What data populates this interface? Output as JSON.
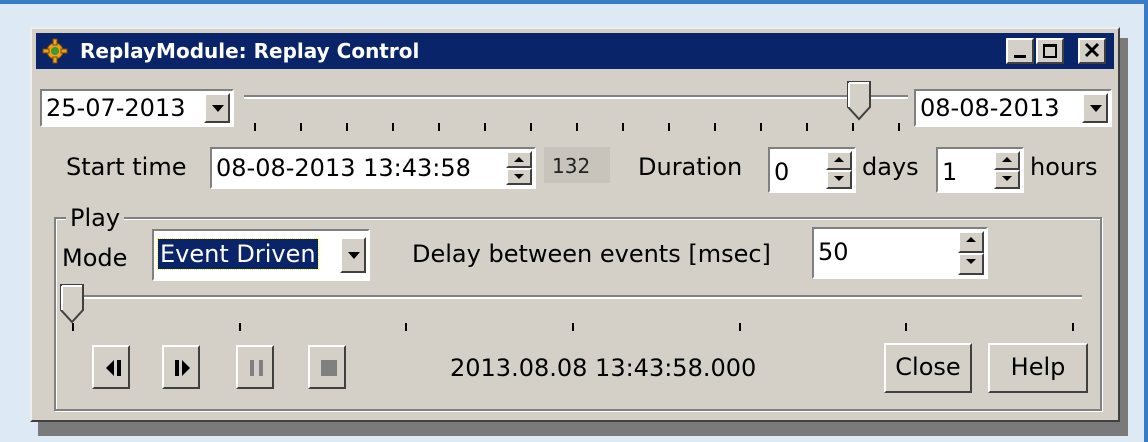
{
  "window": {
    "title": "ReplayModule: Replay Control",
    "controls": [
      "minimize",
      "maximize",
      "close"
    ]
  },
  "range": {
    "start_date": "25-07-2013",
    "end_date": "08-08-2013",
    "slider_position_fraction": 0.94
  },
  "start_time": {
    "label": "Start time",
    "value": "08-08-2013 13:43:58",
    "counter": "132"
  },
  "duration": {
    "label": "Duration",
    "days_value": "0",
    "days_label": "days",
    "hours_value": "1",
    "hours_label": "hours"
  },
  "play": {
    "group_label": "Play",
    "mode_label": "Mode",
    "mode_value": "Event Driven",
    "delay_label": "Delay between events [msec]",
    "delay_value": "50",
    "progress_fraction": 0.0,
    "timestamp": "2013.08.08 13:43:58.000",
    "buttons": {
      "step_back": "step-back-icon",
      "step_forward": "play-step-icon",
      "pause": "pause-icon",
      "stop": "stop-icon",
      "close": "Close",
      "help": "Help"
    }
  },
  "colors": {
    "titlebar": "#0a246a",
    "face": "#d4d0c8",
    "selection": "#0a246a"
  }
}
